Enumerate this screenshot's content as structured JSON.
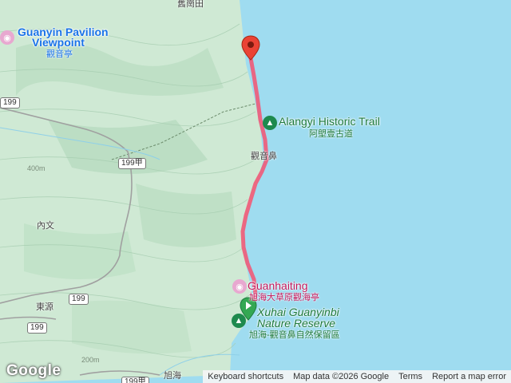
{
  "map": {
    "colors": {
      "water": "#9fdcf0",
      "land": "#cfe9d4",
      "route": "#f05a78",
      "poi_blue": "#1a73e8",
      "poi_green": "#1e7a3e"
    },
    "labels": {
      "top_place": "舊崗田",
      "guanyin_en_1": "Guanyin Pavilion",
      "guanyin_en_2": "Viewpoint",
      "guanyin_zh": "觀音亭",
      "alangyi_en": "Alangyi Historic Trail",
      "alangyi_zh": "阿塱壹古道",
      "guanyinbi": "觀音鼻",
      "neiwen": "內文",
      "dongyuan": "東源",
      "xuhai": "旭海",
      "guanhaiting_en": "Guanhaiting",
      "guanhaiting_zh": "旭海大草原觀海亭",
      "reserve_en_1": "Xuhai Guanyinbi",
      "reserve_en_2": "Nature Reserve",
      "reserve_zh": "旭海-觀音鼻自然保留區",
      "elev_1": "400m",
      "elev_2": "200m"
    },
    "roads": [
      "199",
      "199甲",
      "199",
      "199",
      "199甲"
    ],
    "footer": {
      "shortcuts": "Keyboard shortcuts",
      "map_data": "Map data ©2026 Google",
      "terms": "Terms",
      "report": "Report a map error"
    },
    "logo": "Google",
    "icons": {
      "start_marker": "red-pin-icon",
      "end_marker": "green-pin-icon",
      "camera": "camera-icon",
      "tree": "tree-icon"
    }
  }
}
